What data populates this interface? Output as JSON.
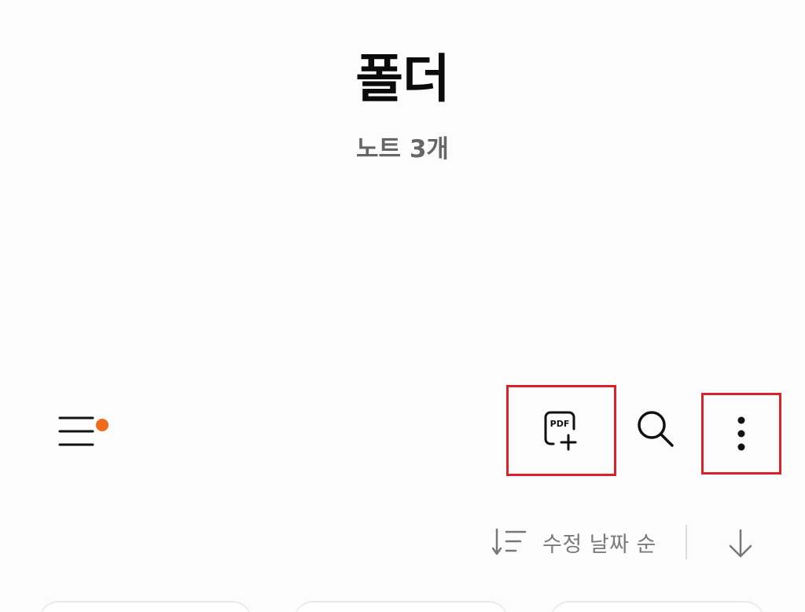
{
  "header": {
    "title": "폴더",
    "subtitle": "노트 3개"
  },
  "toolbar": {
    "menu_icon": "hamburger-menu-icon",
    "badge_color": "#ef6a1a",
    "actions": [
      {
        "name": "pdf-add-button",
        "icon": "pdf-plus-icon"
      },
      {
        "name": "search-button",
        "icon": "search-icon"
      },
      {
        "name": "more-options-button",
        "icon": "kebab-icon"
      }
    ],
    "highlight_color": "#d8232a"
  },
  "sort": {
    "label": "수정 날짜 순",
    "sort_icon": "sort-lines-icon",
    "direction_icon": "arrow-down-icon"
  },
  "notes": {
    "count": 3
  }
}
